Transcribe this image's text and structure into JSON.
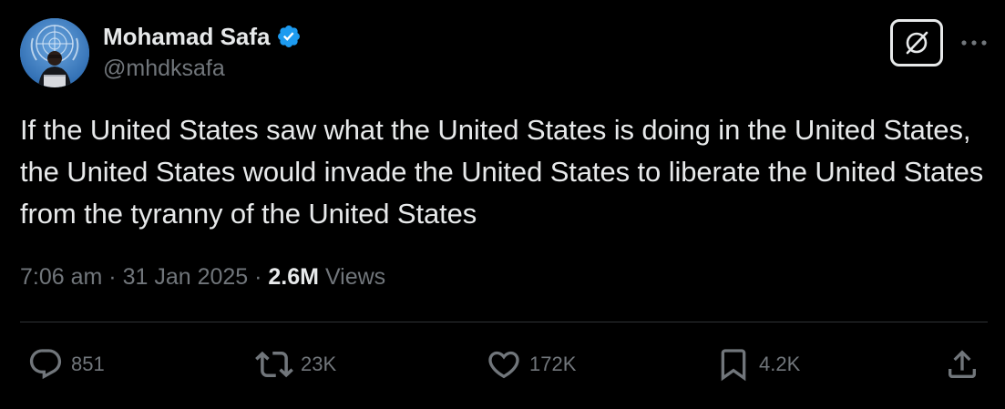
{
  "author": {
    "display_name": "Mohamad Safa",
    "handle": "@mhdksafa",
    "verified": true
  },
  "tweet": {
    "text": "If the United States saw what the United States is doing in the United States, the United States would invade the United States to liberate the United States from the tyranny of the United States"
  },
  "meta": {
    "time": "7:06 am",
    "separator1": " · ",
    "date": "31 Jan 2025",
    "separator2": " · ",
    "views_count": "2.6M",
    "views_label": " Views"
  },
  "actions": {
    "replies": "851",
    "reposts": "23K",
    "likes": "172K",
    "bookmarks": "4.2K"
  },
  "icons": {
    "verified": "verified-badge-icon",
    "grok": "grok-icon",
    "more": "more-horizontal-icon",
    "reply": "reply-icon",
    "repost": "repost-icon",
    "like": "heart-icon",
    "bookmark": "bookmark-icon",
    "share": "share-icon"
  },
  "colors": {
    "background": "#000000",
    "text_primary": "#e7e9ea",
    "text_secondary": "#71767b",
    "verified": "#1d9bf0",
    "divider": "#2f3336"
  }
}
